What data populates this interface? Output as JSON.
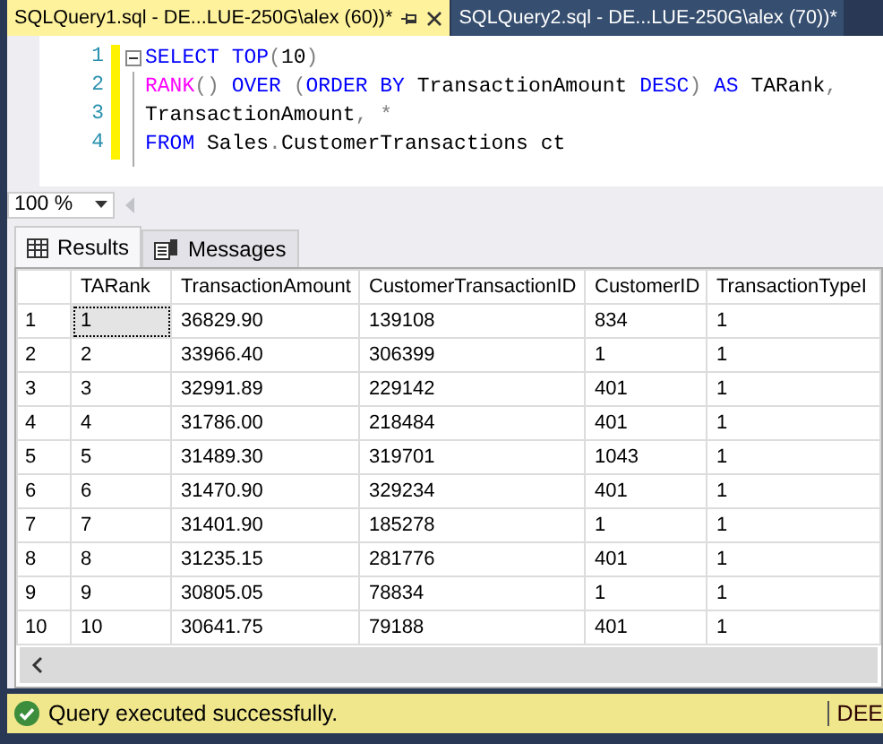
{
  "tabs": [
    {
      "label": "SQLQuery1.sql - DE...LUE-250G\\alex (60))*",
      "selected": true
    },
    {
      "label": "SQLQuery2.sql - DE...LUE-250G\\alex (70))*",
      "selected": false
    }
  ],
  "editor": {
    "lines": [
      {
        "number": "1",
        "tokens": [
          {
            "text": "SELECT",
            "kind": "keyword"
          },
          {
            "text": " TOP",
            "kind": "keyword"
          },
          {
            "text": "(",
            "kind": "operator"
          },
          {
            "text": "10",
            "kind": "plain"
          },
          {
            "text": ")",
            "kind": "operator"
          }
        ]
      },
      {
        "number": "2",
        "tokens": [
          {
            "text": "RANK",
            "kind": "function"
          },
          {
            "text": "()",
            "kind": "operator"
          },
          {
            "text": " OVER",
            "kind": "keyword"
          },
          {
            "text": " (",
            "kind": "operator"
          },
          {
            "text": "ORDER BY",
            "kind": "keyword"
          },
          {
            "text": " TransactionAmount ",
            "kind": "plain"
          },
          {
            "text": "DESC",
            "kind": "keyword"
          },
          {
            "text": ")",
            "kind": "operator"
          },
          {
            "text": " AS",
            "kind": "keyword"
          },
          {
            "text": " TARank",
            "kind": "plain"
          },
          {
            "text": ",",
            "kind": "operator"
          }
        ]
      },
      {
        "number": "3",
        "tokens": [
          {
            "text": "TransactionAmount",
            "kind": "plain"
          },
          {
            "text": ", ",
            "kind": "operator"
          },
          {
            "text": "*",
            "kind": "operator"
          }
        ]
      },
      {
        "number": "4",
        "tokens": [
          {
            "text": "FROM",
            "kind": "keyword"
          },
          {
            "text": " Sales",
            "kind": "plain"
          },
          {
            "text": ".",
            "kind": "operator"
          },
          {
            "text": "CustomerTransactions ct",
            "kind": "plain"
          }
        ]
      }
    ]
  },
  "zoom": "100 %",
  "result_tabs": [
    {
      "label": "Results",
      "selected": true
    },
    {
      "label": "Messages",
      "selected": false
    }
  ],
  "table": {
    "columns": [
      "TARank",
      "TransactionAmount",
      "CustomerTransactionID",
      "CustomerID",
      "TransactionTypeI"
    ],
    "rows": [
      {
        "number": "1",
        "selected": true,
        "cells": [
          "1",
          "36829.90",
          "139108",
          "834",
          "1"
        ]
      },
      {
        "number": "2",
        "selected": false,
        "cells": [
          "2",
          "33966.40",
          "306399",
          "1",
          "1"
        ]
      },
      {
        "number": "3",
        "selected": false,
        "cells": [
          "3",
          "32991.89",
          "229142",
          "401",
          "1"
        ]
      },
      {
        "number": "4",
        "selected": false,
        "cells": [
          "4",
          "31786.00",
          "218484",
          "401",
          "1"
        ]
      },
      {
        "number": "5",
        "selected": false,
        "cells": [
          "5",
          "31489.30",
          "319701",
          "1043",
          "1"
        ]
      },
      {
        "number": "6",
        "selected": false,
        "cells": [
          "6",
          "31470.90",
          "329234",
          "401",
          "1"
        ]
      },
      {
        "number": "7",
        "selected": false,
        "cells": [
          "7",
          "31401.90",
          "185278",
          "1",
          "1"
        ]
      },
      {
        "number": "8",
        "selected": false,
        "cells": [
          "8",
          "31235.15",
          "281776",
          "401",
          "1"
        ]
      },
      {
        "number": "9",
        "selected": false,
        "cells": [
          "9",
          "30805.05",
          "78834",
          "1",
          "1"
        ]
      },
      {
        "number": "10",
        "selected": false,
        "cells": [
          "10",
          "30641.75",
          "79188",
          "401",
          "1"
        ]
      }
    ]
  },
  "status_bar": {
    "message": "Query executed successfully.",
    "server": "DEE"
  }
}
